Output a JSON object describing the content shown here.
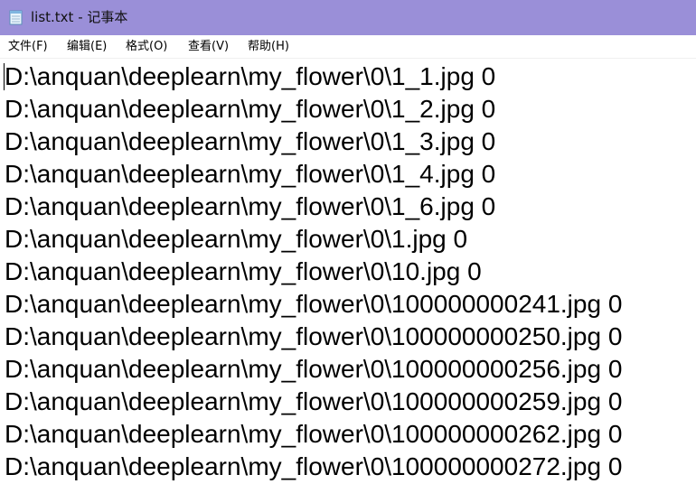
{
  "window": {
    "title": "list.txt - 记事本",
    "icon": "notepad-icon"
  },
  "menu": {
    "items": [
      {
        "label": "文件(F)"
      },
      {
        "label": "编辑(E)"
      },
      {
        "label": "格式(O)"
      },
      {
        "label": "查看(V)"
      },
      {
        "label": "帮助(H)"
      }
    ]
  },
  "editor": {
    "lines": [
      "D:\\anquan\\deeplearn\\my_flower\\0\\1_1.jpg 0",
      "D:\\anquan\\deeplearn\\my_flower\\0\\1_2.jpg 0",
      "D:\\anquan\\deeplearn\\my_flower\\0\\1_3.jpg 0",
      "D:\\anquan\\deeplearn\\my_flower\\0\\1_4.jpg 0",
      "D:\\anquan\\deeplearn\\my_flower\\0\\1_6.jpg 0",
      "D:\\anquan\\deeplearn\\my_flower\\0\\1.jpg 0",
      "D:\\anquan\\deeplearn\\my_flower\\0\\10.jpg 0",
      "D:\\anquan\\deeplearn\\my_flower\\0\\100000000241.jpg 0",
      "D:\\anquan\\deeplearn\\my_flower\\0\\100000000250.jpg 0",
      "D:\\anquan\\deeplearn\\my_flower\\0\\100000000256.jpg 0",
      "D:\\anquan\\deeplearn\\my_flower\\0\\100000000259.jpg 0",
      "D:\\anquan\\deeplearn\\my_flower\\0\\100000000262.jpg 0",
      "D:\\anquan\\deeplearn\\my_flower\\0\\100000000272.jpg 0"
    ]
  },
  "colors": {
    "titlebar": "#9a8fd8",
    "background": "#ffffff",
    "text": "#000000"
  }
}
